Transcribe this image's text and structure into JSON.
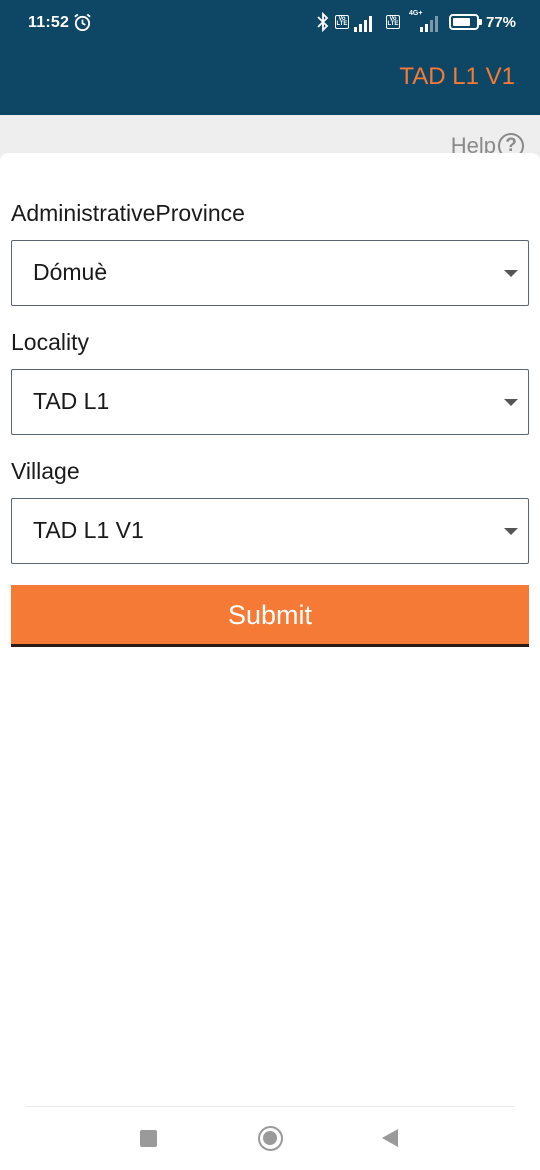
{
  "status_bar": {
    "time": "11:52",
    "battery_percent": "77%",
    "battery_level": 0.77,
    "network": "4G+",
    "icons": [
      "alarm-icon",
      "bluetooth-icon",
      "volte-icon",
      "signal-icon",
      "battery-icon"
    ],
    "volte_text": "Vo LTE"
  },
  "app_bar": {
    "title": "TAD L1 V1",
    "title_color": "#f47a35",
    "background_color": "#0e4766"
  },
  "help": {
    "label": "Help",
    "icon_glyph": "?"
  },
  "form": {
    "province": {
      "label": "AdministrativeProvince",
      "value": "Dómuè"
    },
    "locality": {
      "label": "Locality",
      "value": "TAD L1"
    },
    "village": {
      "label": "Village",
      "value": "TAD L1 V1"
    },
    "submit_label": "Submit",
    "submit_color": "#f47a35"
  },
  "nav_bar": {
    "icons": [
      "recents-icon",
      "home-icon",
      "back-icon"
    ]
  }
}
